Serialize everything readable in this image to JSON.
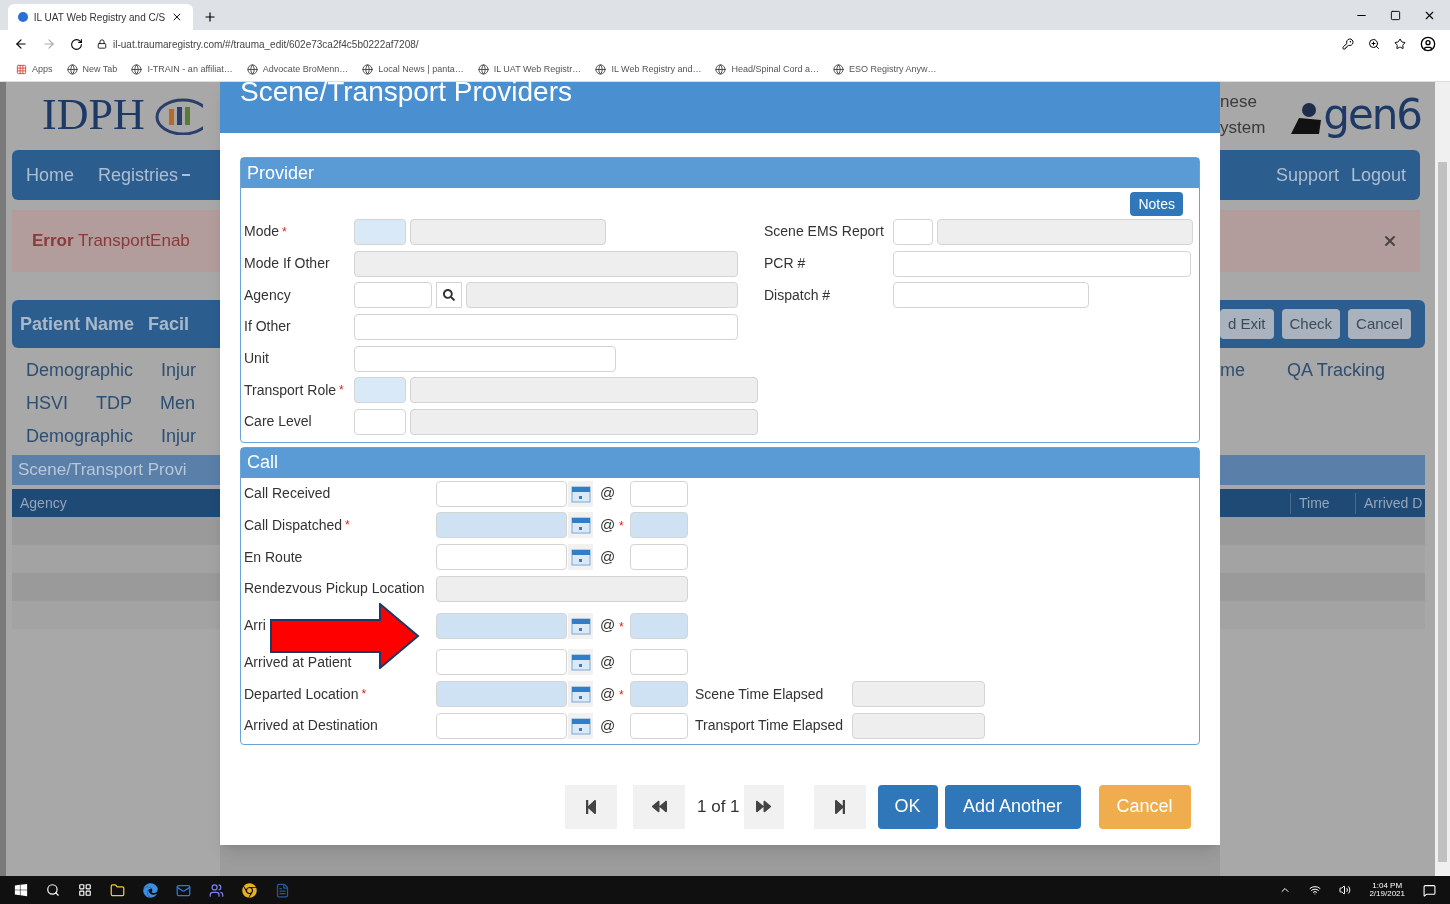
{
  "browser": {
    "tab_title": "IL UAT Web Registry and C/S",
    "address": "il-uat.traumaregistry.com/#/trauma_edit/602e73ca2f4c5b0222af7208/",
    "bookmarks": [
      "Apps",
      "New Tab",
      "I-TRAIN - an affiliat…",
      "Advocate BroMenn…",
      "Local News | panta…",
      "IL UAT Web Registr…",
      "IL Web Registry and…",
      "Head/Spinal Cord a…",
      "ESO Registry Anyw…"
    ]
  },
  "page_left": {
    "logo": "IDPH",
    "nav": [
      {
        "label": "Home",
        "dropdown": false
      },
      {
        "label": "Registries",
        "dropdown": true
      }
    ],
    "error": {
      "title": "Error",
      "message": "TransportEnab"
    },
    "patient_header": [
      "Patient Name",
      "Facil"
    ],
    "tab_rows": [
      [
        "Demographic",
        "Injur"
      ],
      [
        "HSVI",
        "TDP",
        "Men"
      ],
      [
        "Demographic",
        "Injur"
      ]
    ],
    "section_title": "Scene/Transport Provi",
    "table_columns": [
      "Agency"
    ]
  },
  "page_right": {
    "header_lines": [
      "nese",
      "ystem"
    ],
    "logo": "gen6",
    "nav": [
      "Support",
      "Logout"
    ],
    "header_buttons": [
      "d Exit",
      "Check",
      "Cancel"
    ],
    "tabs": [
      "me",
      "QA Tracking"
    ],
    "table_columns": [
      "Time",
      "Arrived D"
    ]
  },
  "modal": {
    "title": "Scene/Transport Providers",
    "required_mark": "*",
    "provider": {
      "title": "Provider",
      "notes_button": "Notes",
      "left_rows": [
        {
          "label": "Mode",
          "required": true,
          "lookup": false,
          "inputs": [
            {
              "disabled": false
            },
            {
              "disabled": true
            }
          ]
        },
        {
          "label": "Mode If Other",
          "required": false,
          "lookup": false,
          "inputs": [
            {
              "disabled": true
            }
          ]
        },
        {
          "label": "Agency",
          "required": false,
          "lookup": true,
          "inputs": [
            {
              "disabled": false
            },
            {
              "disabled": true
            }
          ]
        },
        {
          "label": "If Other",
          "required": false,
          "lookup": false,
          "inputs": [
            {
              "disabled": false
            }
          ]
        },
        {
          "label": "Unit",
          "required": false,
          "lookup": false,
          "inputs": [
            {
              "disabled": false
            }
          ]
        },
        {
          "label": "Transport Role",
          "required": true,
          "lookup": false,
          "inputs": [
            {
              "disabled": false
            },
            {
              "disabled": true
            }
          ]
        },
        {
          "label": "Care Level",
          "required": false,
          "lookup": false,
          "inputs": [
            {
              "disabled": false
            },
            {
              "disabled": true
            }
          ]
        }
      ],
      "right_rows": [
        {
          "label": "Scene EMS Report",
          "required": false,
          "lookup": false,
          "inputs": [
            {
              "disabled": false
            },
            {
              "disabled": true
            }
          ]
        },
        {
          "label": "PCR #",
          "required": false,
          "lookup": false,
          "inputs": [
            {
              "disabled": false
            }
          ]
        },
        {
          "label": "Dispatch #",
          "required": false,
          "lookup": false,
          "inputs": [
            {
              "disabled": false
            }
          ]
        }
      ]
    },
    "call": {
      "title": "Call",
      "rows": [
        {
          "kind": "datetime",
          "label": "Call Received",
          "required": false,
          "label_mark": false,
          "time_mark": false,
          "separator": "@"
        },
        {
          "kind": "datetime",
          "label": "Call Dispatched",
          "required": true,
          "label_mark": true,
          "time_mark": true,
          "separator": "@"
        },
        {
          "kind": "datetime",
          "label": "En Route",
          "required": false,
          "label_mark": false,
          "time_mark": false,
          "separator": "@"
        },
        {
          "kind": "text",
          "label": "Rendezvous Pickup Location",
          "required": false,
          "label_mark": false,
          "disabled": true
        },
        {
          "kind": "datetime",
          "label": "Arri",
          "required": true,
          "label_mark": false,
          "time_mark": true,
          "separator": "@",
          "arrow": true
        },
        {
          "kind": "datetime",
          "label": "Arrived at Patient",
          "required": false,
          "label_mark": false,
          "time_mark": false,
          "separator": "@"
        },
        {
          "kind": "datetime",
          "label": "Departed Location",
          "required": true,
          "label_mark": true,
          "time_mark": true,
          "separator": "@",
          "extra": "Scene Time Elapsed"
        },
        {
          "kind": "datetime",
          "label": "Arrived at Destination",
          "required": false,
          "label_mark": false,
          "time_mark": false,
          "separator": "@",
          "extra": "Transport Time Elapsed"
        }
      ]
    },
    "pager": "1 of 1",
    "buttons": [
      {
        "label": "OK",
        "kind": "primary"
      },
      {
        "label": "Add Another",
        "kind": "primary"
      },
      {
        "label": "Cancel",
        "kind": "warning"
      }
    ]
  },
  "taskbar": {
    "time": "1:04 PM",
    "date": "2/19/2021"
  }
}
